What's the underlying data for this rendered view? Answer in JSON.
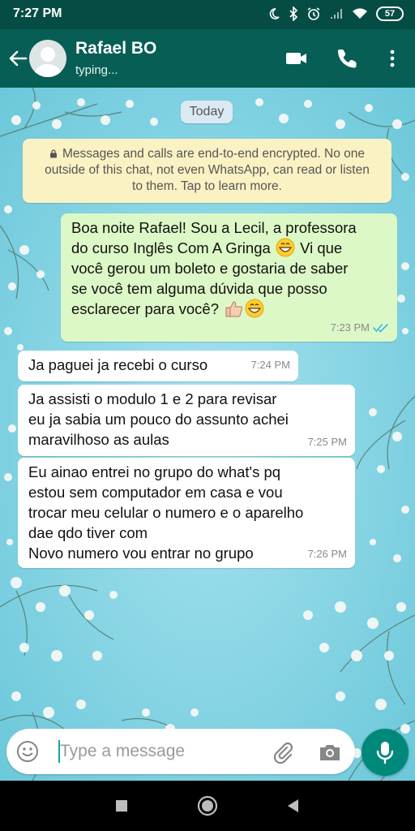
{
  "status_bar": {
    "time": "7:27 PM",
    "battery": "57",
    "icons": [
      "moon-icon",
      "bluetooth-icon",
      "alarm-icon",
      "signal-icon",
      "wifi-icon",
      "battery-icon"
    ]
  },
  "header": {
    "contact_name": "Rafael BO",
    "status": "typing...",
    "icons": [
      "back-arrow-icon",
      "video-call-icon",
      "phone-icon",
      "more-vert-icon"
    ]
  },
  "chat": {
    "date_chip": "Today",
    "encryption_notice": {
      "lines": [
        "Messages and calls are end-to-end encrypted. No one",
        "outside of this chat, not even WhatsApp, can read or listen",
        "to them. Tap to learn more."
      ]
    },
    "messages": [
      {
        "direction": "outgoing",
        "lines": [
          "Boa noite Rafael! Sou a Lecil, a professora",
          "do curso Inglês Com A Gringa",
          "Vi que",
          "você gerou um boleto e gostaria de saber",
          "se você tem alguma dúvida que posso",
          "esclarecer para você?"
        ],
        "emojis": [
          "grinning-face",
          "thumbs-up",
          "grinning-face"
        ],
        "time": "7:23 PM",
        "read_receipt": "double-check-blue"
      },
      {
        "direction": "incoming",
        "lines": [
          "Ja paguei ja recebi o curso"
        ],
        "time": "7:24 PM"
      },
      {
        "direction": "incoming",
        "lines": [
          "Ja assisti o modulo 1 e 2 para revisar",
          "eu ja sabia um pouco do assunto achei",
          "maravilhoso as aulas"
        ],
        "time": "7:25 PM"
      },
      {
        "direction": "incoming",
        "lines": [
          "Eu ainao entrei no grupo do what's pq",
          "estou sem computador em casa e vou",
          "trocar meu celular o numero e o aparelho",
          "dae qdo tiver com",
          "Novo numero vou entrar no grupo"
        ],
        "time": "7:26 PM"
      }
    ]
  },
  "input_bar": {
    "placeholder": "Type a message",
    "value": "",
    "icons": [
      "emoji-icon",
      "attach-icon",
      "camera-icon",
      "mic-icon"
    ]
  },
  "nav_bar": {
    "icons": [
      "recents-icon",
      "home-icon",
      "back-icon"
    ]
  },
  "colors": {
    "header": "#075e54",
    "status_bar": "#054d44",
    "outgoing_bubble": "#dcf8c6",
    "incoming_bubble": "#ffffff",
    "encryption_bg": "#fbf2c4",
    "read_receipt": "#34b7f1",
    "mic_button": "#00897b"
  }
}
